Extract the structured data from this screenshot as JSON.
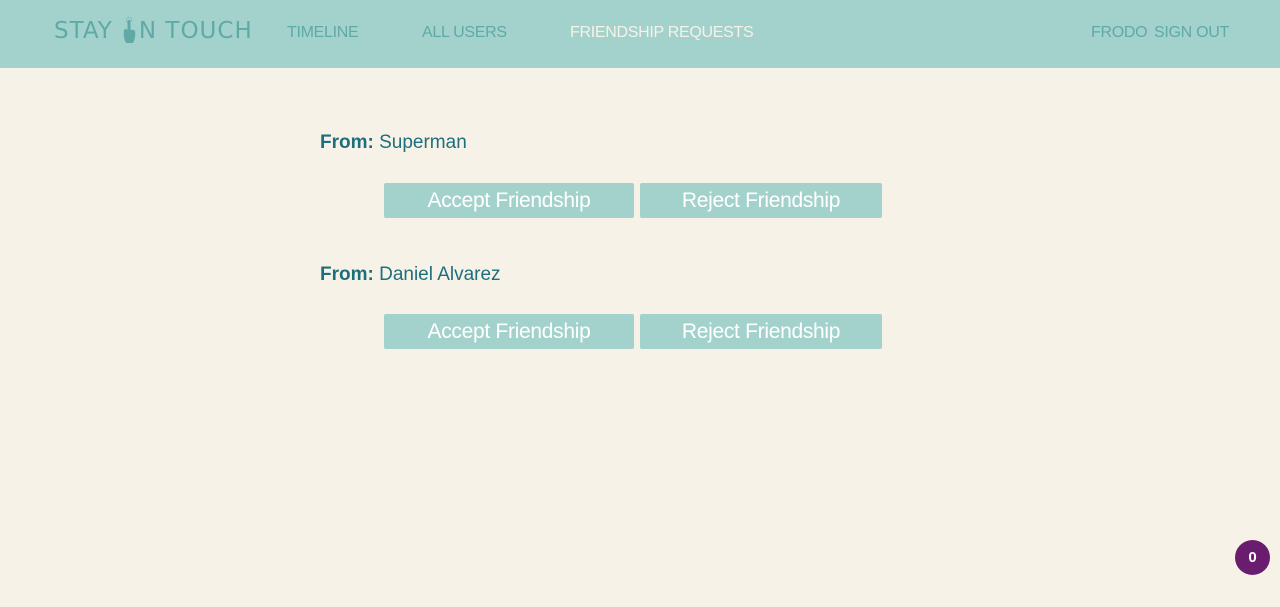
{
  "navbar": {
    "logo_text_left": "STAY",
    "logo_text_right": "N TOUCH",
    "logo_icon": "pointing-hand-icon",
    "links": [
      {
        "label": "TIMELINE",
        "active": false
      },
      {
        "label": "ALL USERS",
        "active": false
      },
      {
        "label": "FRIENDSHIP REQUESTS",
        "active": true
      }
    ],
    "user_name": "FRODO",
    "sign_out_label": "SIGN OUT"
  },
  "requests": [
    {
      "from_label": "From:",
      "from_name": "Superman",
      "accept_label": "Accept Friendship",
      "reject_label": "Reject Friendship"
    },
    {
      "from_label": "From:",
      "from_name": "Daniel Alvarez",
      "accept_label": "Accept Friendship",
      "reject_label": "Reject Friendship"
    }
  ],
  "notification_badge": {
    "count": "0"
  },
  "colors": {
    "navbar_bg": "#a3d2cc",
    "nav_text": "#5fa9a7",
    "nav_active": "#f6f2e8",
    "page_bg": "#f6f2e8",
    "from_text": "#1e6e7c",
    "button_bg": "#a3d2cc",
    "badge_bg": "#6a1c6e"
  }
}
